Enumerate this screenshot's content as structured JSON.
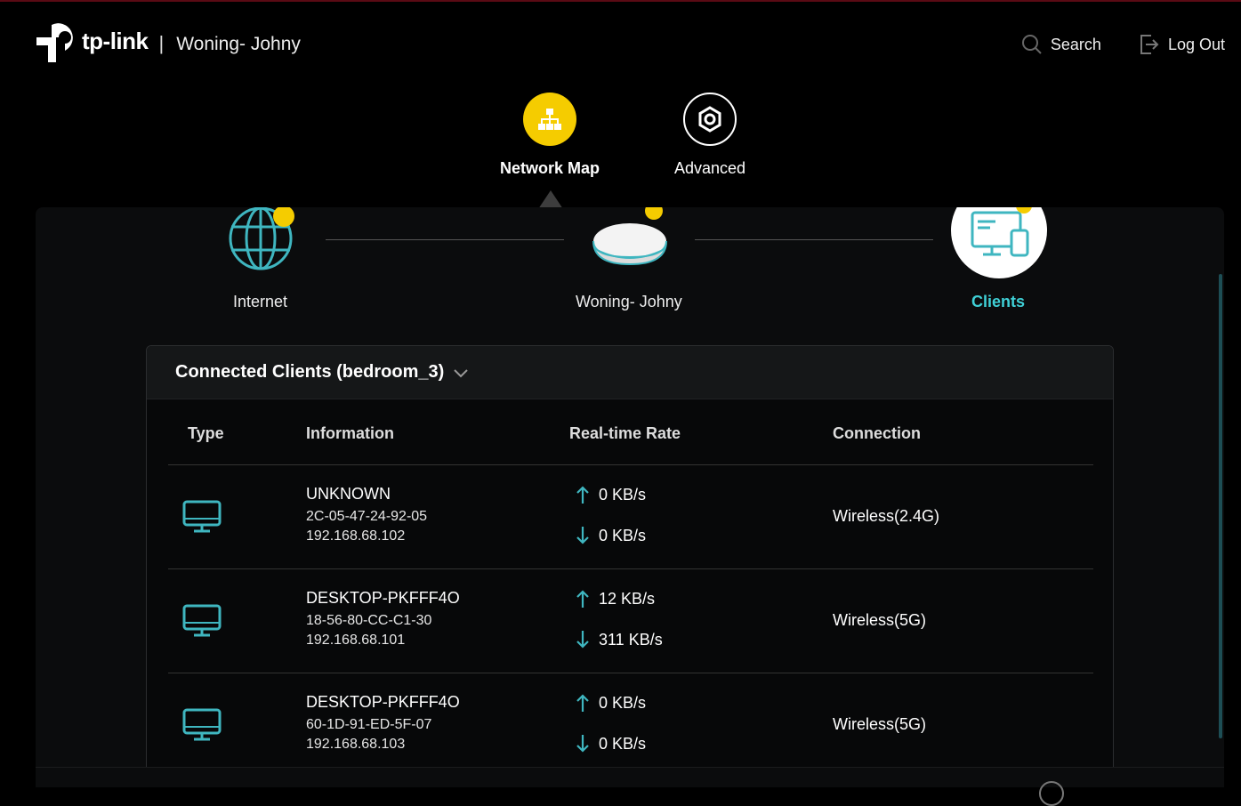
{
  "header": {
    "brand": "tp-link",
    "separator": "|",
    "router_name": "Woning- Johny",
    "search_label": "Search",
    "logout_label": "Log Out"
  },
  "nav": {
    "network_map_label": "Network Map",
    "advanced_label": "Advanced",
    "active": "Network Map"
  },
  "topology": {
    "internet_label": "Internet",
    "router_label": "Woning- Johny",
    "clients_label": "Clients"
  },
  "clients": {
    "title": "Connected Clients (bedroom_3)",
    "columns": {
      "type": "Type",
      "information": "Information",
      "rate": "Real-time Rate",
      "connection": "Connection"
    },
    "rows": [
      {
        "type_icon": "desktop-icon",
        "name": "UNKNOWN",
        "mac": "2C-05-47-24-92-05",
        "ip": "192.168.68.102",
        "upload": "0 KB/s",
        "download": "0 KB/s",
        "connection": "Wireless(2.4G)"
      },
      {
        "type_icon": "desktop-icon",
        "name": "DESKTOP-PKFFF4O",
        "mac": "18-56-80-CC-C1-30",
        "ip": "192.168.68.101",
        "upload": "12 KB/s",
        "download": "311 KB/s",
        "connection": "Wireless(5G)"
      },
      {
        "type_icon": "desktop-icon",
        "name": "DESKTOP-PKFFF4O",
        "mac": "60-1D-91-ED-5F-07",
        "ip": "192.168.68.103",
        "upload": "0 KB/s",
        "download": "0 KB/s",
        "connection": "Wireless(5G)"
      }
    ]
  },
  "colors": {
    "accent_teal": "#3fd0d6",
    "accent_yellow": "#f5cc00",
    "background": "#000000"
  }
}
